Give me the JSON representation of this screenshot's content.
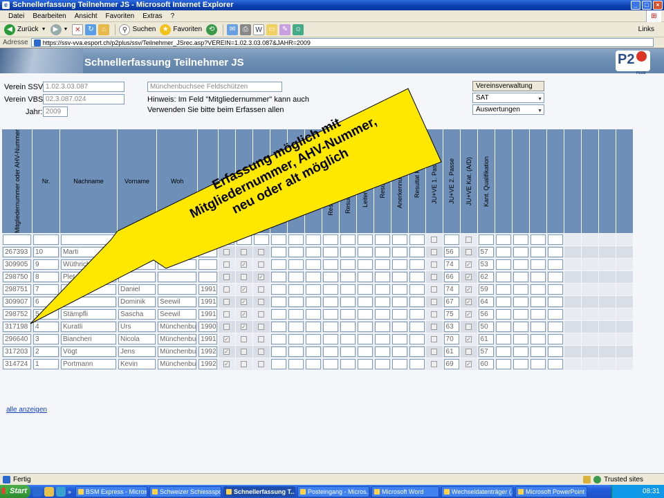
{
  "window": {
    "title": "Schnellerfassung Teilnehmer JS - Microsoft Internet Explorer"
  },
  "menu": [
    "Datei",
    "Bearbeiten",
    "Ansicht",
    "Favoriten",
    "Extras",
    "?"
  ],
  "toolbar": {
    "back": "Zurück",
    "search": "Suchen",
    "favorites": "Favoriten",
    "links": "Links"
  },
  "address": {
    "label": "Adresse",
    "url": "https://ssv-vva.esport.ch/p2plus/ssv/Teilnehmer_JSrec.asp?VEREIN=1.02.3.03.087&JAHR=2009"
  },
  "banner": {
    "title": "Schnellerfassung Teilnehmer JS",
    "logo": "P2",
    "logo_sub": "PLUS"
  },
  "form": {
    "verein_ssv_label": "Verein SSV:",
    "verein_ssv_value": "1.02.3.03.087",
    "verein_vbs_label": "Verein VBS:",
    "verein_vbs_value": "02.3.087.024",
    "jahr_label": "Jahr:",
    "jahr_value": "2009",
    "club_name": "Münchenbuchsee Feldschützen",
    "hint1": "Hinweis: Im Feld \"Mitgliedernummer\" kann auch",
    "hint2": "Verwenden Sie bitte beim Erfassen allen",
    "btn_vereinsverwaltung": "Vereinsverwaltung",
    "select_sat": "SAT",
    "select_auswertungen": "Auswertungen"
  },
  "table": {
    "headers": [
      "Mitgliedernummer oder AHV-Nummer",
      "Nr.",
      "Nachname",
      "Vorname",
      "Woh",
      "",
      "",
      "",
      "",
      "",
      "Resultat Präzision",
      "Resultat Wettkampf",
      "Resultat Hauptschiessen",
      "Resultat Wettschiessen",
      "Leiter am Wettsch.",
      "Resultat OP",
      "Anerkennungskarte",
      "Resultat FS",
      "JU+VE 1. Passe",
      "JU+VE 2. Passe",
      "JU+VE Kat. (A/D)",
      "Kant. Qualifikation"
    ],
    "rows": [
      {
        "nr_mitglied": "267393",
        "nr": "10",
        "nachname": "Marti",
        "vorname": "",
        "wohnort": "",
        "jahrgang": "",
        "op": "56",
        "fs": "57",
        "chk": [
          false,
          false,
          false
        ],
        "ak": false
      },
      {
        "nr_mitglied": "309905",
        "nr": "9",
        "nachname": "Wüthrich",
        "vorname": "",
        "wohnort": "",
        "jahrgang": "",
        "op": "74",
        "fs": "53",
        "chk": [
          false,
          true,
          false
        ],
        "ak": true
      },
      {
        "nr_mitglied": "298750",
        "nr": "8",
        "nachname": "Plet",
        "vorname": "",
        "wohnort": "",
        "jahrgang": "",
        "op": "66",
        "fs": "62",
        "chk": [
          false,
          false,
          true
        ],
        "ak": true
      },
      {
        "nr_mitglied": "298751",
        "nr": "7",
        "nachname": "",
        "vorname": "Daniel",
        "wohnort": "",
        "jahrgang": "1991",
        "op": "74",
        "fs": "59",
        "chk": [
          false,
          true,
          false
        ],
        "ak": true
      },
      {
        "nr_mitglied": "309907",
        "nr": "6",
        "nachname": "",
        "vorname": "Dominik",
        "wohnort": "Seewil",
        "jahrgang": "1991",
        "op": "67",
        "fs": "64",
        "chk": [
          false,
          true,
          false
        ],
        "ak": true
      },
      {
        "nr_mitglied": "298752",
        "nr": "5",
        "nachname": "Stämpfli",
        "vorname": "Sascha",
        "wohnort": "Seewil",
        "jahrgang": "1991",
        "op": "75",
        "fs": "56",
        "chk": [
          false,
          true,
          false
        ],
        "ak": true
      },
      {
        "nr_mitglied": "317198",
        "nr": "4",
        "nachname": "Kuratli",
        "vorname": "Urs",
        "wohnort": "Münchenbu",
        "jahrgang": "1990",
        "op": "63",
        "fs": "50",
        "chk": [
          false,
          true,
          false
        ],
        "ak": false
      },
      {
        "nr_mitglied": "296640",
        "nr": "3",
        "nachname": "Biancheri",
        "vorname": "Nicola",
        "wohnort": "Münchenbu",
        "jahrgang": "1991",
        "op": "70",
        "fs": "61",
        "chk": [
          true,
          false,
          false
        ],
        "ak": true
      },
      {
        "nr_mitglied": "317203",
        "nr": "2",
        "nachname": "Vögt",
        "vorname": "Jens",
        "wohnort": "Münchenbu",
        "jahrgang": "1992",
        "op": "61",
        "fs": "57",
        "chk": [
          true,
          false,
          false
        ],
        "ak": false
      },
      {
        "nr_mitglied": "314724",
        "nr": "1",
        "nachname": "Portmann",
        "vorname": "Kevin",
        "wohnort": "Münchenbu",
        "jahrgang": "1992",
        "op": "69",
        "fs": "60",
        "chk": [
          true,
          false,
          false
        ],
        "ak": true
      }
    ],
    "show_all": "alle anzeigen"
  },
  "callout": {
    "line1": "Erfassung möglich mit",
    "line2": "Mitgliedernummer, AHV-Nummer,",
    "line3": "neu oder alt möglich",
    "fill": "#ffe800"
  },
  "status": {
    "left": "Fertig",
    "zone": "Trusted sites"
  },
  "taskbar": {
    "start": "Start",
    "tasks": [
      "BSM Express - Micros...",
      "Schweizer Schiessspo...",
      "Schnellerfassung T...",
      "Posteingang - Micros...",
      "Microsoft Word",
      "Wechseldatenträger (...",
      "Microsoft PowerPoint ..."
    ],
    "active_task": 2,
    "clock": "08:31"
  }
}
